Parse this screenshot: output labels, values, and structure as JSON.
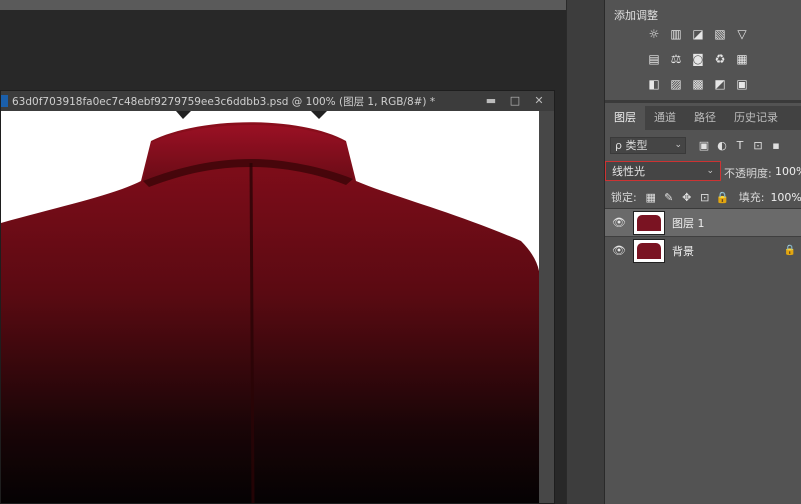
{
  "document": {
    "title": "63d0f703918fa0ec7c48ebf9279759ee3c6ddbb3.psd @ 100% (图层 1, RGB/8#) *",
    "window_buttons": [
      "▬",
      "□",
      "✕"
    ]
  },
  "adjustments": {
    "title": "添加调整",
    "row1": [
      "☼",
      "▥",
      "◪",
      "▧",
      "▽"
    ],
    "row2": [
      "▤",
      "⚖",
      "◙",
      "♻",
      "▦"
    ],
    "row3": [
      "◧",
      "▨",
      "▩",
      "◩",
      "▣"
    ]
  },
  "layers_panel": {
    "tabs": [
      "图层",
      "通道",
      "路径",
      "历史记录"
    ],
    "active_tab": "图层",
    "filter": {
      "label": "ρ 类型",
      "icons": [
        "▣",
        "◐",
        "T",
        "⊡",
        "▪"
      ]
    },
    "blend_mode": "线性光",
    "opacity_label": "不透明度:",
    "opacity_value": "100%",
    "lock_label": "锁定:",
    "lock_icons": [
      "▦",
      "✎",
      "✥",
      "⊡",
      "🔒"
    ],
    "fill_label": "填充:",
    "fill_value": "100%",
    "layers": [
      {
        "name": "图层 1",
        "selected": true,
        "locked": false
      },
      {
        "name": "背景",
        "selected": false,
        "locked": true
      }
    ]
  },
  "colors": {
    "accent_highlight": "#cc3333",
    "jacket_red": "#7a1322"
  }
}
